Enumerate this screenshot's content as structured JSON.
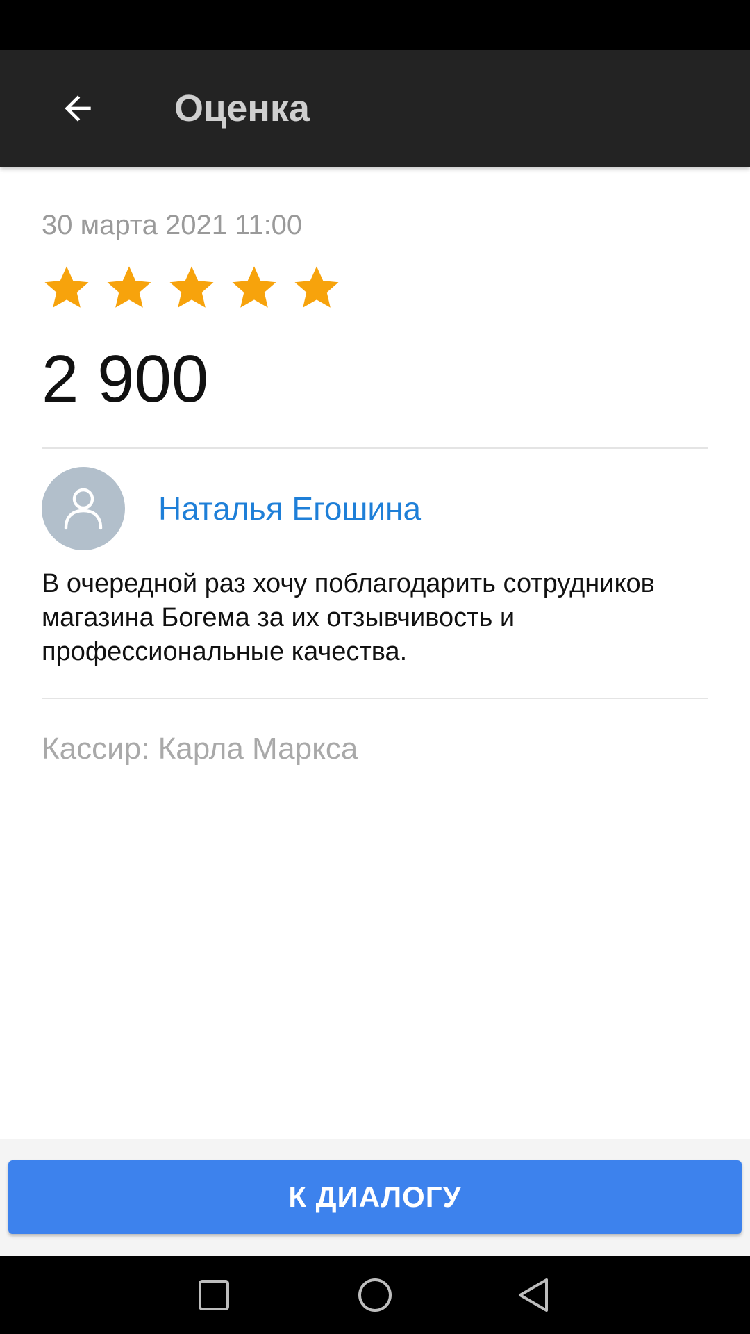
{
  "app_bar": {
    "title": "Оценка",
    "back_icon": "arrow-back-icon"
  },
  "review": {
    "date": "30 марта 2021 11:00",
    "rating": 5,
    "rating_max": 5,
    "amount": "2 900",
    "author_name": "Наталья Егошина",
    "avatar_icon": "person-icon",
    "text": "В очередной раз хочу поблагодарить сотрудников магазина Богема за их отзывчивость и профессиональные качества.",
    "cashier": "Кассир: Карла Маркса"
  },
  "actions": {
    "dialog_button": "К ДИАЛОГУ"
  },
  "nav": {
    "recents_icon": "square-icon",
    "home_icon": "circle-icon",
    "back_icon": "triangle-back-icon"
  },
  "colors": {
    "star": "#f7a30c",
    "accent": "#3d82ed",
    "link": "#1e7fd8",
    "app_bar": "#232323"
  }
}
